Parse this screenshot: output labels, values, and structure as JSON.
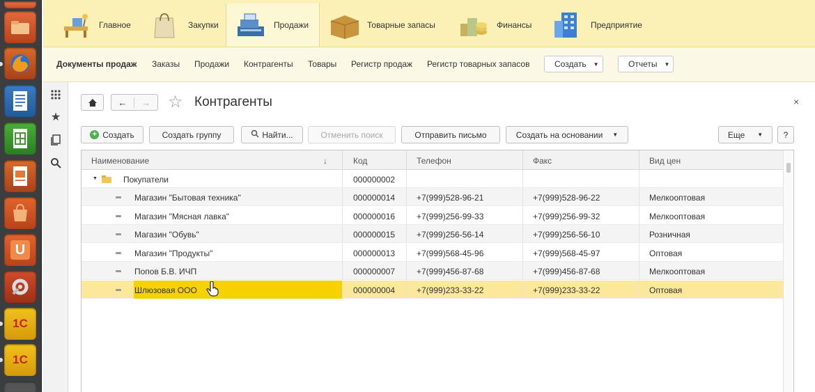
{
  "sections": [
    {
      "label": "Главное",
      "icon": "desk-icon"
    },
    {
      "label": "Закупки",
      "icon": "shopping-bag-icon"
    },
    {
      "label": "Продажи",
      "icon": "cash-register-icon"
    },
    {
      "label": "Товарные запасы",
      "icon": "box-icon"
    },
    {
      "label": "Финансы",
      "icon": "coins-icon"
    },
    {
      "label": "Предприятие",
      "icon": "building-icon"
    }
  ],
  "commands": {
    "items": [
      "Документы продаж",
      "Заказы",
      "Продажи",
      "Контрагенты",
      "Товары",
      "Регистр продаж",
      "Регистр товарных запасов"
    ],
    "create_label": "Создать",
    "reports_label": "Отчеты"
  },
  "form": {
    "title": "Контрагенты",
    "close": "×"
  },
  "toolbar": {
    "create": "Создать",
    "create_group": "Создать группу",
    "find": "Найти...",
    "cancel_search": "Отменить поиск",
    "send_letter": "Отправить письмо",
    "create_based_on": "Создать на основании",
    "more": "Еще",
    "help": "?"
  },
  "table": {
    "columns": [
      "Наименование",
      "Код",
      "Телефон",
      "Факс",
      "Вид цен"
    ],
    "sort_indicator": "↓",
    "group": {
      "name": "Покупатели",
      "code": "000000002"
    },
    "rows": [
      {
        "name": "Магазин \"Бытовая техника\"",
        "code": "000000014",
        "phone": "+7(999)528-96-21",
        "fax": "+7(999)528-96-22",
        "price": "Мелкооптовая"
      },
      {
        "name": "Магазин \"Мясная лавка\"",
        "code": "000000016",
        "phone": "+7(999)256-99-33",
        "fax": "+7(999)256-99-32",
        "price": "Мелкооптовая"
      },
      {
        "name": "Магазин \"Обувь\"",
        "code": "000000015",
        "phone": "+7(999)256-56-14",
        "fax": "+7(999)256-56-10",
        "price": "Розничная"
      },
      {
        "name": "Магазин \"Продукты\"",
        "code": "000000013",
        "phone": "+7(999)568-45-96",
        "fax": "+7(999)568-45-97",
        "price": "Оптовая"
      },
      {
        "name": "Попов Б.В. ИЧП",
        "code": "000000007",
        "phone": "+7(999)456-87-68",
        "fax": "+7(999)456-87-68",
        "price": "Мелкооптовая"
      },
      {
        "name": "Шлюзовая ООО",
        "code": "000000004",
        "phone": "+7(999)233-33-22",
        "fax": "+7(999)233-33-22",
        "price": "Оптовая"
      }
    ],
    "selected_row": 5
  },
  "colors": {
    "sections_bg": "#fbf1b6",
    "selected_row": "#fbe89a",
    "selected_cell": "#f6d300"
  }
}
